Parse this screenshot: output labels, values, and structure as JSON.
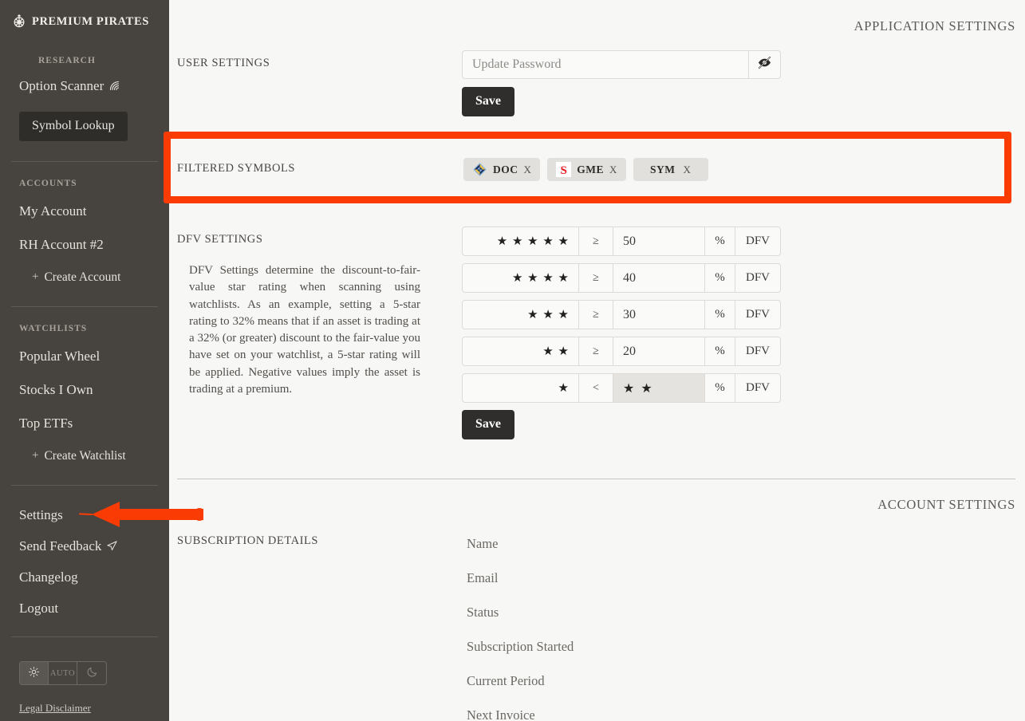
{
  "sidebar": {
    "brand": {
      "name": "PREMIUM PIRATES",
      "icon": "ship-wheel-icon"
    },
    "research": {
      "label": "RESEARCH",
      "option_scanner": "Option Scanner",
      "option_scanner_icon": "radar-scan-icon",
      "symbol_lookup": "Symbol Lookup"
    },
    "accounts": {
      "label": "ACCOUNTS",
      "items": [
        "My Account",
        "RH Account #2"
      ],
      "create": "Create Account"
    },
    "watchlists": {
      "label": "WATCHLISTS",
      "items": [
        "Popular Wheel",
        "Stocks I Own",
        "Top ETFs"
      ],
      "create": "Create Watchlist"
    },
    "bottom": {
      "items": [
        "Settings",
        "Send Feedback",
        "Changelog",
        "Logout"
      ],
      "send_feedback_icon": "paper-plane-icon"
    },
    "theme": {
      "light": "sun-icon",
      "auto_label": "AUTO",
      "dark": "moon-icon",
      "active": "light"
    },
    "legal": "Legal Disclaimer"
  },
  "main": {
    "application_settings_title": "APPLICATION SETTINGS",
    "account_settings_title": "ACCOUNT SETTINGS",
    "user_settings": {
      "label": "USER SETTINGS",
      "password_placeholder": "Update Password",
      "password_value": "",
      "toggle_icon": "eye-slash-icon",
      "save_label": "Save"
    },
    "filtered_symbols": {
      "label": "FILTERED SYMBOLS",
      "chips": [
        {
          "symbol": "DOC",
          "remove": "X",
          "logo": "doc-diamond-logo"
        },
        {
          "symbol": "GME",
          "remove": "X",
          "logo": "gme-gs-logo"
        },
        {
          "symbol": "SYM",
          "remove": "X",
          "logo": "none"
        }
      ]
    },
    "dfv_settings": {
      "label": "DFV SETTINGS",
      "description": "DFV Settings determine the discount-to-fair-value star rating when scanning using watchlists. As an example, setting a 5-star rating to 32% means that if an asset is trading at a 32% (or greater) discount to the fair-value you have set on your watchlist, a 5-star rating will be applied. Negative values imply the asset is trading at a premium.",
      "rows": [
        {
          "stars": "★ ★ ★ ★ ★",
          "op": "≥",
          "value": "50",
          "pct": "%",
          "unit": "DFV",
          "disabled": false
        },
        {
          "stars": "★ ★ ★ ★",
          "op": "≥",
          "value": "40",
          "pct": "%",
          "unit": "DFV",
          "disabled": false
        },
        {
          "stars": "★ ★ ★",
          "op": "≥",
          "value": "30",
          "pct": "%",
          "unit": "DFV",
          "disabled": false
        },
        {
          "stars": "★ ★",
          "op": "≥",
          "value": "20",
          "pct": "%",
          "unit": "DFV",
          "disabled": false
        },
        {
          "stars": "★",
          "op": "<",
          "value": "★ ★",
          "pct": "%",
          "unit": "DFV",
          "disabled": true
        }
      ],
      "save_label": "Save"
    },
    "subscription": {
      "label": "SUBSCRIPTION DETAILS",
      "fields": [
        "Name",
        "Email",
        "Status",
        "Subscription Started",
        "Current Period",
        "Next Invoice"
      ]
    }
  },
  "annotations": {
    "highlight_color": "#fa3c04",
    "arrow_color": "#fa3c04",
    "highlight_target": "filtered-symbols-row",
    "arrow_target": "sidebar-item-settings"
  }
}
